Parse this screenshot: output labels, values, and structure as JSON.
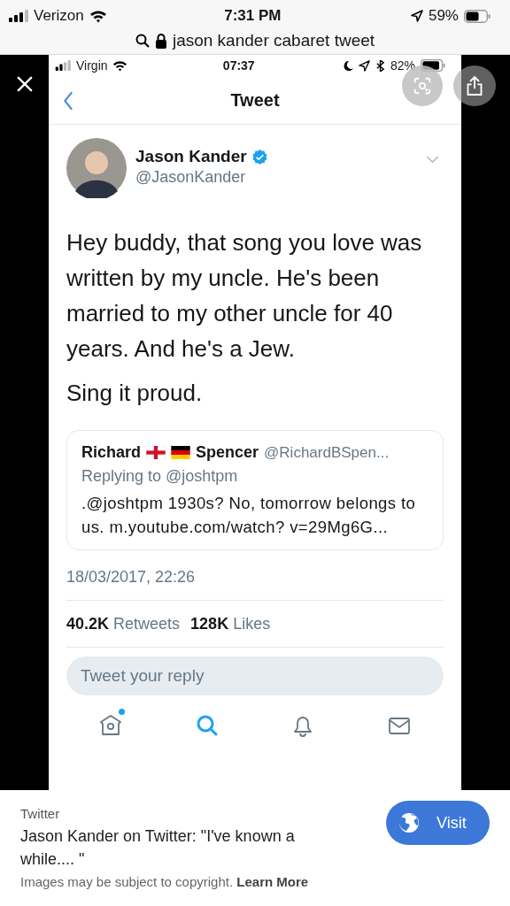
{
  "status_bar": {
    "carrier": "Verizon",
    "time": "7:31 PM",
    "battery": "59%"
  },
  "address_bar": {
    "query": "jason kander cabaret tweet"
  },
  "viewer": {
    "screenshot": {
      "status_bar": {
        "carrier": "Virgin",
        "time": "07:37",
        "battery": "82%"
      },
      "nav": {
        "title": "Tweet"
      },
      "tweet": {
        "name": "Jason Kander",
        "verified": true,
        "handle": "@JasonKander",
        "paragraphs": [
          "Hey buddy, that song you love was written by my uncle. He's been married to my other uncle for 40 years. And he's a Jew.",
          "Sing it proud."
        ],
        "quote": {
          "name_parts": [
            {
              "kind": "text",
              "text": "Richard"
            },
            {
              "kind": "england_flag"
            },
            {
              "kind": "germany_flag"
            },
            {
              "kind": "text",
              "text": "Spencer"
            }
          ],
          "handle": "@RichardBSpen...",
          "replying": "Replying to @joshtpm",
          "body": ".@joshtpm 1930s? No, tomorrow belongs to us. m.youtube.com/watch? v=29Mg6G..."
        },
        "timestamp": "18/03/2017, 22:26",
        "stats": [
          {
            "count": "40.2K",
            "label": "Retweets"
          },
          {
            "count": "128K",
            "label": "Likes"
          }
        ],
        "reply_placeholder": "Tweet your reply"
      },
      "tab_bar": [
        {
          "kind": "home",
          "selected": false,
          "dot": true
        },
        {
          "kind": "search",
          "selected": true,
          "dot": false
        },
        {
          "kind": "notifications",
          "selected": false,
          "dot": false
        },
        {
          "kind": "messages",
          "selected": false,
          "dot": false
        }
      ]
    }
  },
  "result": {
    "source": "Twitter",
    "title": "Jason Kander on Twitter: \"I've known a while.... \"",
    "button": "Visit",
    "notice": "Images may be subject to copyright.",
    "notice_link": "Learn More"
  }
}
